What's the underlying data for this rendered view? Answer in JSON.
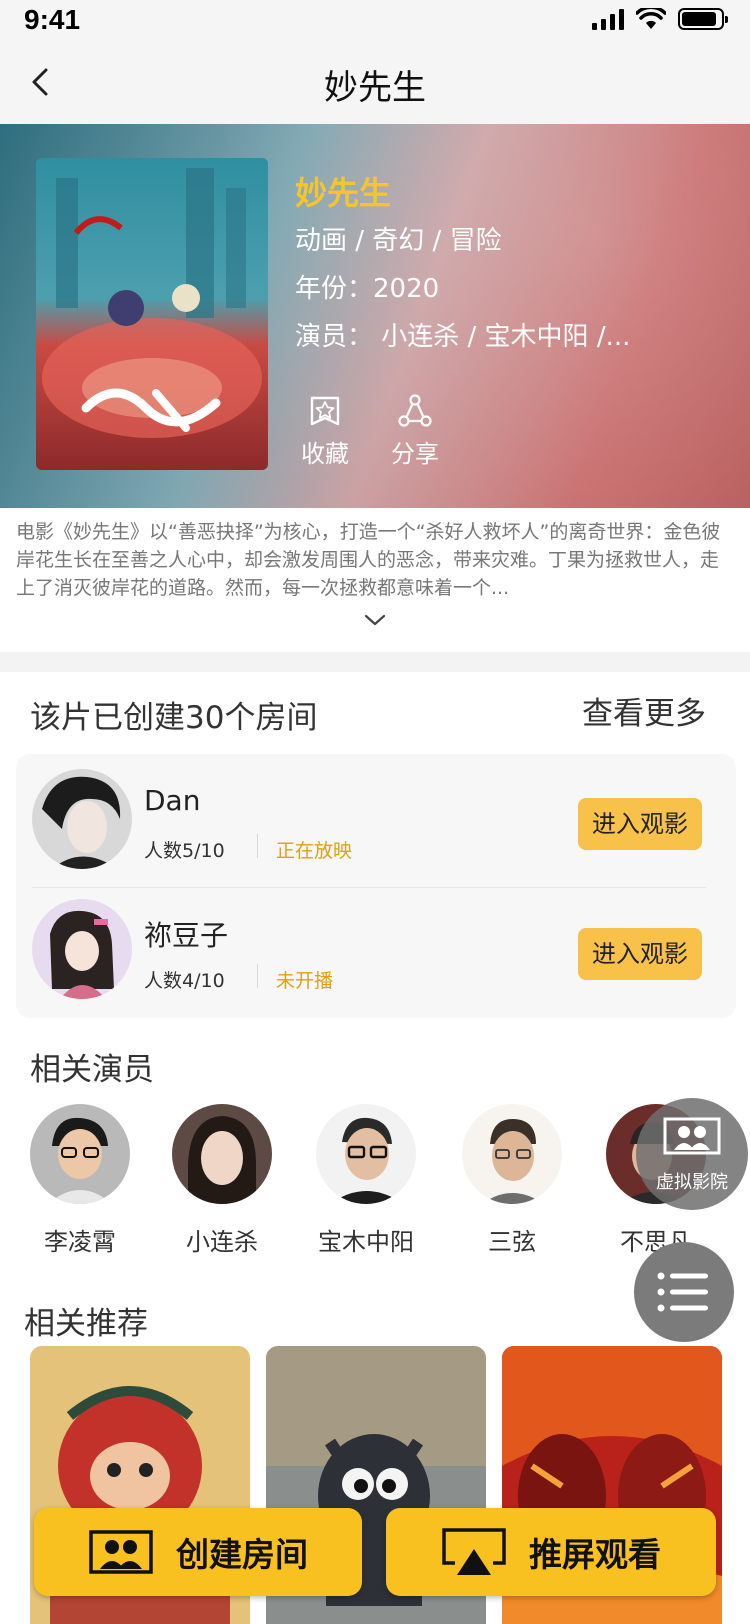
{
  "status_bar": {
    "time": "9:41"
  },
  "navbar": {
    "title": "妙先生"
  },
  "movie": {
    "title": "妙先生",
    "genre": "动画 / 奇幻 / 冒险",
    "year": "年份：2020",
    "cast": "演员： 小连杀 / 宝木中阳 /...",
    "favorite_label": "收藏",
    "share_label": "分享",
    "synopsis": "电影《妙先生》以“善恶抉择”为核心，打造一个“杀好人救坏人”的离奇世界：金色彼岸花生长在至善之人心中，却会激发周围人的恶念，带来灾难。丁果为拯救世人，走上了消灭彼岸花的道路。然而，每一次拯救都意味着一个..."
  },
  "rooms": {
    "heading": "该片已创建30个房间",
    "more_label": "查看更多",
    "items": [
      {
        "name": "Dan",
        "count": "人数5/10",
        "status": "正在放映",
        "button": "进入观影"
      },
      {
        "name": "祢豆子",
        "count": "人数4/10",
        "status": "未开播",
        "button": "进入观影"
      }
    ]
  },
  "actors": {
    "heading": "相关演员",
    "items": [
      {
        "name": "李凌霄"
      },
      {
        "name": "小连杀"
      },
      {
        "name": "宝木中阳"
      },
      {
        "name": "三弦"
      },
      {
        "name": "不思凡"
      }
    ]
  },
  "floating": {
    "virtual_cinema_label": "虚拟影院"
  },
  "recommend": {
    "heading": "相关推荐"
  },
  "bottom": {
    "create_room": "创建房间",
    "cast_screen": "推屏观看"
  },
  "colors": {
    "accent": "#f8c11f",
    "title_gold": "#f6c52c",
    "status_orange": "#e0a010"
  }
}
